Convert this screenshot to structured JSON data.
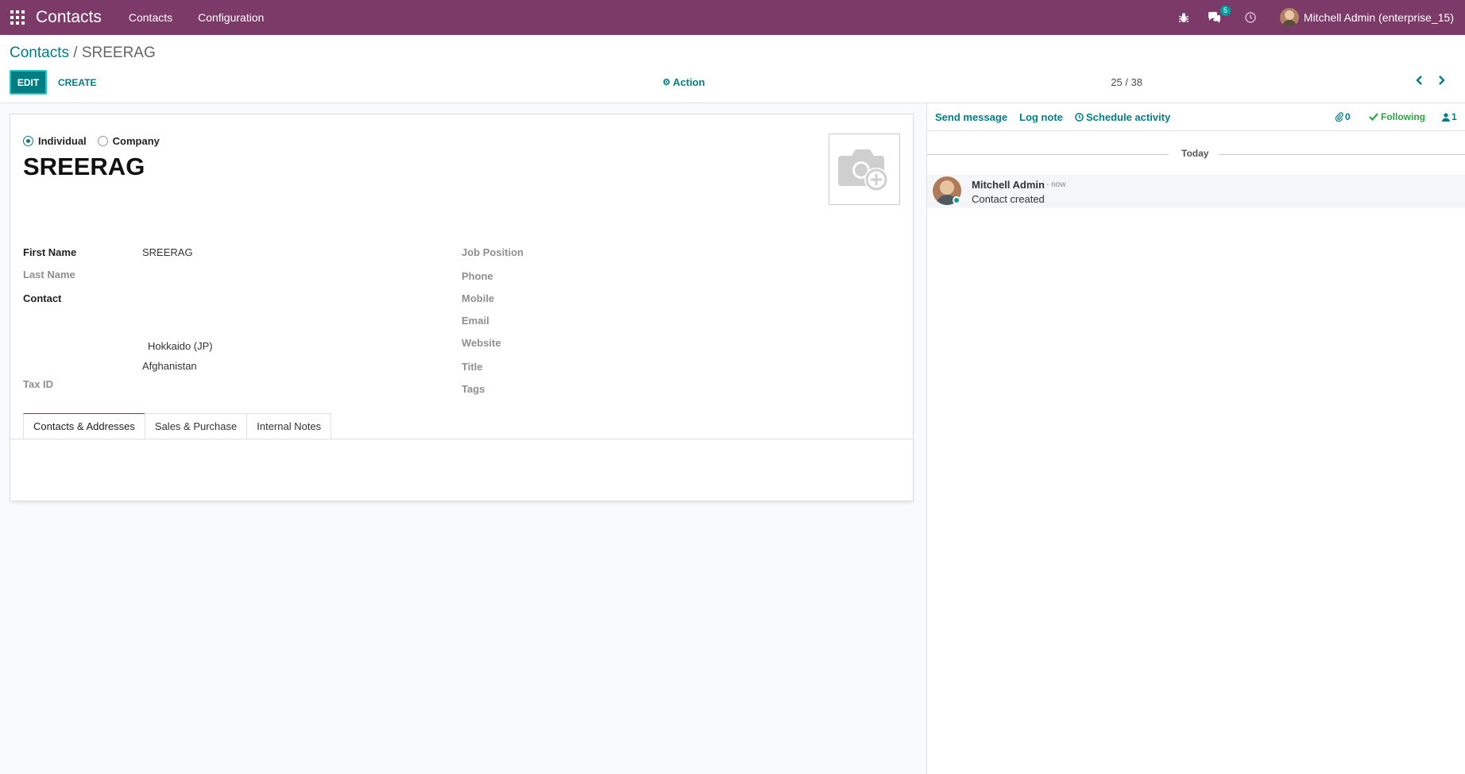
{
  "navbar": {
    "brand": "Contacts",
    "menu": [
      "Contacts",
      "Configuration"
    ],
    "messages_count": "5",
    "user": "Mitchell Admin (enterprise_15)"
  },
  "breadcrumb": {
    "parent": "Contacts",
    "separator": " / ",
    "current": "SREERAG"
  },
  "buttons": {
    "edit": "EDIT",
    "create": "CREATE",
    "action": "Action"
  },
  "pager": {
    "value": "25 / 38"
  },
  "form": {
    "company_type": {
      "individual": "Individual",
      "company": "Company",
      "selected": "Individual"
    },
    "name": "SREERAG",
    "left_fields": {
      "first_name_label": "First Name",
      "first_name_value": "SREERAG",
      "last_name_label": "Last Name",
      "contact_label": "Contact",
      "state_value": "Hokkaido (JP)",
      "country_value": "Afghanistan",
      "tax_id_label": "Tax ID"
    },
    "right_fields": {
      "job_position": "Job Position",
      "phone": "Phone",
      "mobile": "Mobile",
      "email": "Email",
      "website": "Website",
      "title": "Title",
      "tags": "Tags"
    },
    "tabs": [
      "Contacts & Addresses",
      "Sales & Purchase",
      "Internal Notes"
    ]
  },
  "chatter": {
    "send_message": "Send message",
    "log_note": "Log note",
    "schedule_activity": "Schedule activity",
    "attachments_count": "0",
    "following": "Following",
    "followers_count": "1",
    "date_separator": "Today",
    "messages": [
      {
        "author": "Mitchell Admin",
        "date": "- now",
        "body": "Contact created"
      }
    ]
  },
  "colors": {
    "navbar": "#7c3a69",
    "primary": "#017e84",
    "following": "#28a745"
  }
}
